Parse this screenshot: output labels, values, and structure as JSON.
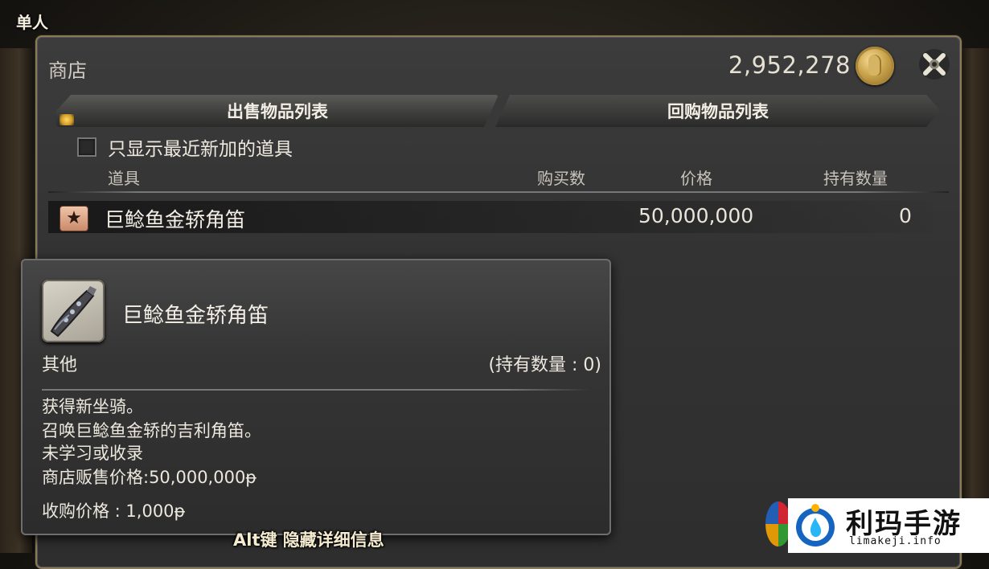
{
  "player": {
    "label": "单人"
  },
  "window": {
    "title": "商店",
    "gil": "2,952,278"
  },
  "tabs": [
    {
      "label": "出售物品列表",
      "active": true
    },
    {
      "label": "回购物品列表",
      "active": false
    }
  ],
  "filter": {
    "label": "只显示最近新加的道具",
    "checked": false
  },
  "columns": {
    "item": "道具",
    "quantity": "购买数",
    "price": "价格",
    "owned": "持有数量"
  },
  "items": [
    {
      "name": "巨鲶鱼金轿角笛",
      "price": "50,000,000",
      "owned": "0",
      "icon": "star-icon"
    }
  ],
  "tooltip": {
    "title": "巨鲶鱼金轿角笛",
    "category": "其他",
    "owned": "(持有数量 : 0)",
    "description": [
      "获得新坐骑。",
      "召唤巨鲶鱼金轿的吉利角笛。",
      "未学习或收录",
      "商店贩售价格:50,000,000ᵽ",
      "收购价格 : 1,000ᵽ"
    ],
    "icon": "horn-icon"
  },
  "hint": "Alt键 隐藏详细信息",
  "watermark": {
    "text": "利玛手游",
    "url": "limakeji.info"
  }
}
